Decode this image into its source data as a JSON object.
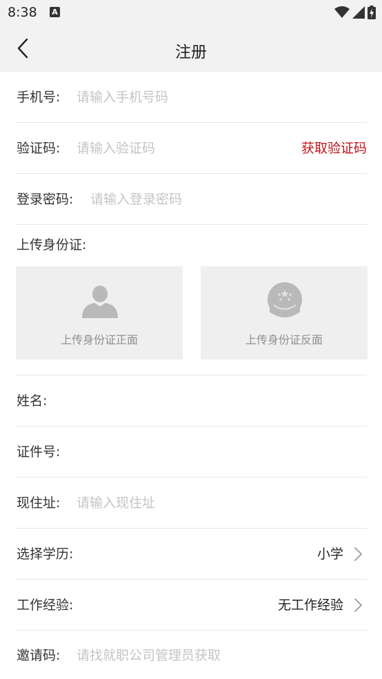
{
  "status_bar": {
    "time": "8:38",
    "notif_icon_letter": "A",
    "icons": [
      "wifi-icon",
      "cell-signal-icon",
      "battery-charging-icon"
    ]
  },
  "header": {
    "title": "注册",
    "back_icon": "chevron-left-icon"
  },
  "form": {
    "phone": {
      "label": "手机号:",
      "placeholder": "请输入手机号码",
      "value": ""
    },
    "code": {
      "label": "验证码:",
      "placeholder": "请输入验证码",
      "value": "",
      "action": "获取验证码"
    },
    "password": {
      "label": "登录密码:",
      "placeholder": "请输入登录密码",
      "value": ""
    },
    "id_upload": {
      "label": "上传身份证:",
      "front": {
        "caption": "上传身份证正面",
        "icon": "person-silhouette-icon"
      },
      "back": {
        "caption": "上传身份证反面",
        "icon": "national-emblem-icon"
      }
    },
    "name": {
      "label": "姓名:",
      "value": ""
    },
    "id_number": {
      "label": "证件号:",
      "value": ""
    },
    "address": {
      "label": "现住址:",
      "placeholder": "请输入现住址",
      "value": ""
    },
    "education": {
      "label": "选择学历:",
      "value": "小学"
    },
    "experience": {
      "label": "工作经验:",
      "value": "无工作经验"
    },
    "invite_code": {
      "label": "邀请码:",
      "placeholder": "请找就职公司管理员获取",
      "value": ""
    }
  },
  "colors": {
    "accent": "#c0141b",
    "header_bg": "#f2f2f2",
    "placeholder": "#c4c4c4",
    "divider": "#e6e6e6",
    "card_bg": "#efefef"
  }
}
